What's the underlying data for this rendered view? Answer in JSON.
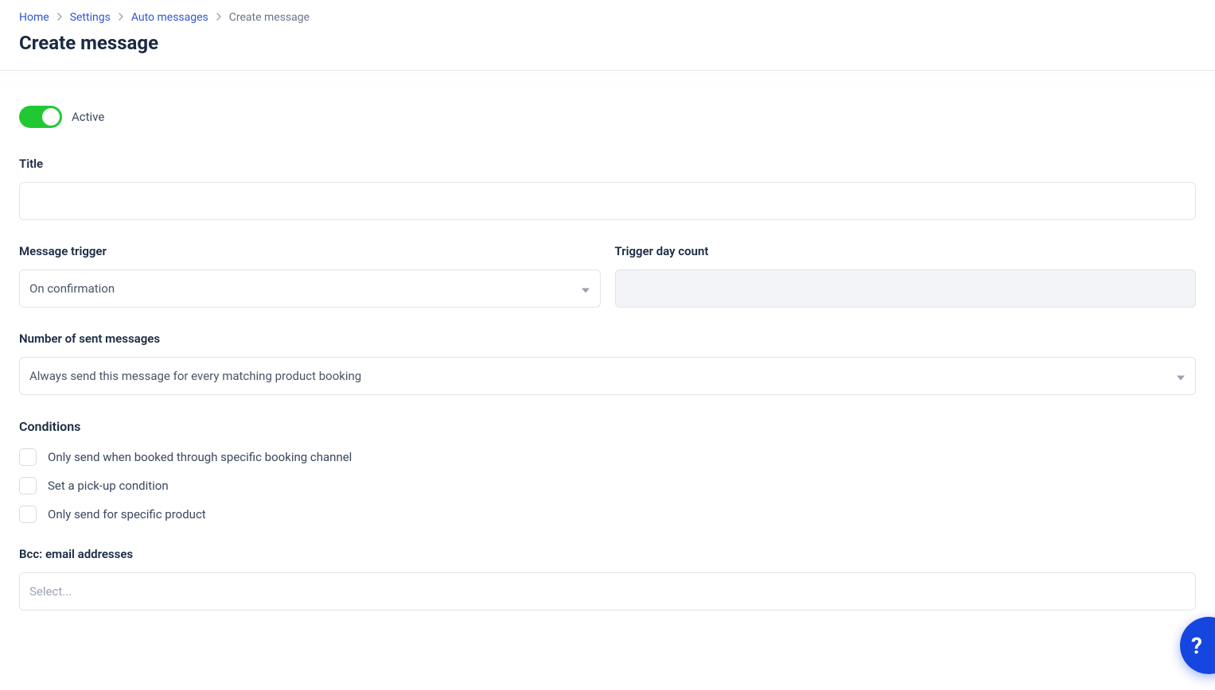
{
  "breadcrumb": {
    "items": [
      {
        "label": "Home"
      },
      {
        "label": "Settings"
      },
      {
        "label": "Auto messages"
      }
    ],
    "current": "Create message"
  },
  "page": {
    "title": "Create message"
  },
  "form": {
    "active": {
      "label": "Active",
      "state": "on"
    },
    "title": {
      "label": "Title",
      "value": ""
    },
    "message_trigger": {
      "label": "Message trigger",
      "value": "On confirmation"
    },
    "trigger_day_count": {
      "label": "Trigger day count",
      "value": "",
      "disabled": true
    },
    "sent_count": {
      "label": "Number of sent messages",
      "value": "Always send this message for every matching product booking"
    },
    "conditions": {
      "heading": "Conditions",
      "items": [
        {
          "label": "Only send when booked through specific booking channel",
          "checked": false
        },
        {
          "label": "Set a pick-up condition",
          "checked": false
        },
        {
          "label": "Only send for specific product",
          "checked": false
        }
      ]
    },
    "bcc": {
      "label": "Bcc: email addresses",
      "placeholder": "Select..."
    }
  },
  "fab": {
    "glyph": "?"
  }
}
